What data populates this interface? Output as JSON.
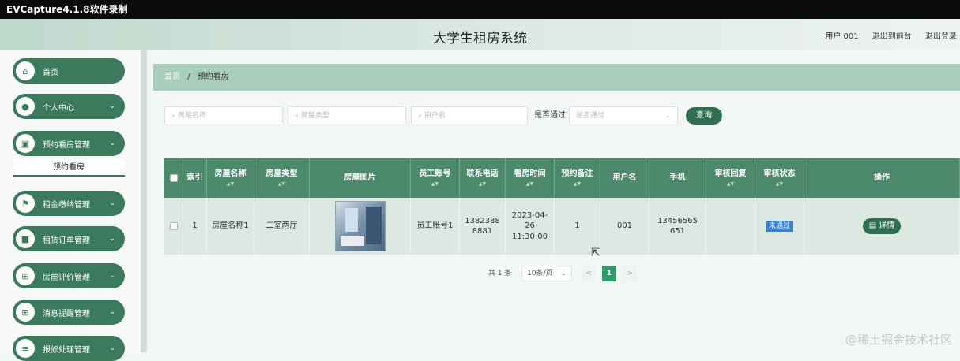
{
  "recorder": {
    "title": "EVCapture4.1.8软件录制"
  },
  "header": {
    "title": "大学生租房系统",
    "links": [
      "用户 001",
      "退出到前台",
      "退出登录"
    ]
  },
  "sidebar": {
    "items": [
      {
        "label": "首页",
        "icon": "home-icon"
      },
      {
        "label": "个人中心",
        "icon": "user-icon"
      },
      {
        "label": "预约看房管理",
        "icon": "calendar-icon"
      },
      {
        "label": "租金缴纳管理",
        "icon": "flag-icon"
      },
      {
        "label": "租赁订单管理",
        "icon": "video-icon"
      },
      {
        "label": "房屋评价管理",
        "icon": "grid-icon"
      },
      {
        "label": "消息提醒管理",
        "icon": "grid-icon"
      },
      {
        "label": "报修处理管理",
        "icon": "list-icon"
      }
    ],
    "active_sub": "预约看房"
  },
  "breadcrumb": {
    "home": "首页",
    "sep": "/",
    "current": "预约看房"
  },
  "search": {
    "house_name_placeholder": "房屋名称",
    "house_type_placeholder": "房屋类型",
    "username_placeholder": "用户名",
    "pass_label": "是否通过",
    "pass_placeholder": "是否通过",
    "query_label": "查询"
  },
  "table": {
    "headers": [
      "索引",
      "房屋名称",
      "房屋类型",
      "房屋图片",
      "员工账号",
      "联系电话",
      "看房时间",
      "预约备注",
      "用户名",
      "手机",
      "审核回复",
      "审核状态",
      "操作"
    ],
    "rows": [
      {
        "index": "1",
        "house_name": "房屋名称1",
        "house_type": "二室两厅",
        "staff_account": "员工账号1",
        "phone": "13823888881",
        "view_time": "2023-04-26 11:30:00",
        "remark": "1",
        "username": "001",
        "mobile": "13456565651",
        "reply": "",
        "status": "未通过",
        "action": "详情"
      }
    ]
  },
  "pager": {
    "total": "共 1 条",
    "page_size": "10条/页",
    "current_page": "1",
    "prev": "<",
    "next": ">"
  },
  "watermark": "@稀土掘金技术社区"
}
